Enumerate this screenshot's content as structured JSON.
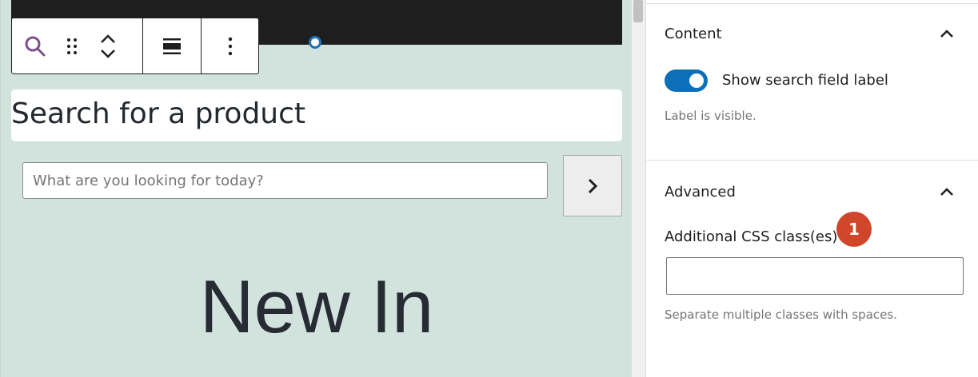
{
  "editor": {
    "toolbar": {
      "search_icon": "search-icon",
      "drag_icon": "drag-handle-icon",
      "move_up_icon": "chevron-up-icon",
      "move_down_icon": "chevron-down-icon",
      "align_icon": "align-wide-icon",
      "options_icon": "more-vertical-icon"
    },
    "search_label": "Search for a product",
    "search_placeholder": "What are you looking for today?",
    "search_submit_icon": "chevron-right-icon",
    "heading": "New In",
    "colors": {
      "canvas_bg": "#d2e3de",
      "accent": "#1f72b8",
      "icon_purple": "#7e4f8e"
    }
  },
  "sidebar": {
    "content": {
      "title": "Content",
      "toggle_label": "Show search field label",
      "toggle_on": true,
      "help": "Label is visible."
    },
    "advanced": {
      "title": "Advanced",
      "css_label": "Additional CSS class(es)",
      "css_value": "",
      "help": "Separate multiple classes with spaces.",
      "badge": "1"
    },
    "colors": {
      "toggle_on": "#0b70b7",
      "badge": "#d0462b"
    }
  }
}
